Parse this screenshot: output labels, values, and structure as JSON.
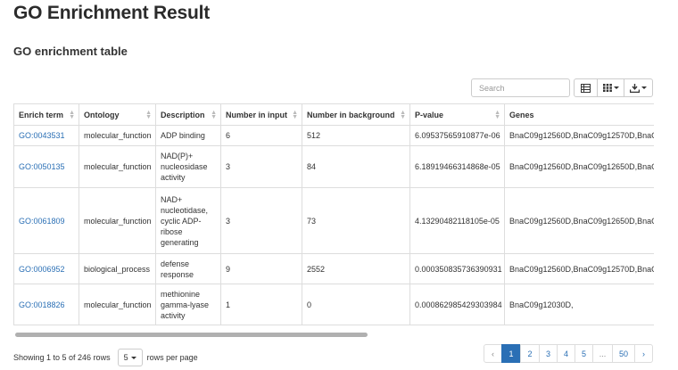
{
  "page": {
    "title": "GO Enrichment Result",
    "section_title": "GO enrichment table"
  },
  "toolbar": {
    "search_placeholder": "Search",
    "buttons": [
      {
        "icon": "list-view-icon"
      },
      {
        "icon": "columns-grid-icon"
      },
      {
        "icon": "export-icon"
      }
    ]
  },
  "table": {
    "headers": [
      "Enrich term",
      "Ontology",
      "Description",
      "Number in input",
      "Number in background",
      "P-value",
      "Genes"
    ],
    "rows": [
      {
        "term": "GO:0043531",
        "ontology": "molecular_function",
        "description": "ADP binding",
        "input": "6",
        "background": "512",
        "pvalue": "6.09537565910877e-06",
        "genes": "BnaC09g12560D,BnaC09g12570D,BnaC"
      },
      {
        "term": "GO:0050135",
        "ontology": "molecular_function",
        "description": "NAD(P)+ nucleosidase activity",
        "input": "3",
        "background": "84",
        "pvalue": "6.18919466314868e-05",
        "genes": "BnaC09g12560D,BnaC09g12650D,BnaC"
      },
      {
        "term": "GO:0061809",
        "ontology": "molecular_function",
        "description": "NAD+ nucleotidase, cyclic ADP-ribose generating",
        "input": "3",
        "background": "73",
        "pvalue": "4.13290482118105e-05",
        "genes": "BnaC09g12560D,BnaC09g12650D,BnaC"
      },
      {
        "term": "GO:0006952",
        "ontology": "biological_process",
        "description": "defense response",
        "input": "9",
        "background": "2552",
        "pvalue": "0.000350835736390931",
        "genes": "BnaC09g12560D,BnaC09g12570D,BnaC"
      },
      {
        "term": "GO:0018826",
        "ontology": "molecular_function",
        "description": "methionine gamma-lyase activity",
        "input": "1",
        "background": "0",
        "pvalue": "0.000862985429303984",
        "genes": "BnaC09g12030D,"
      }
    ]
  },
  "footer": {
    "showing_text": "Showing 1 to 5 of 246 rows",
    "page_size": "5",
    "rows_per_page_text": "rows per page",
    "pages": [
      "‹",
      "1",
      "2",
      "3",
      "4",
      "5",
      "...",
      "50",
      "›"
    ],
    "active_page": "1"
  },
  "colors": {
    "link": "#2a6fb5",
    "active_page_bg": "#2a6fb5",
    "border": "#dddddd"
  }
}
